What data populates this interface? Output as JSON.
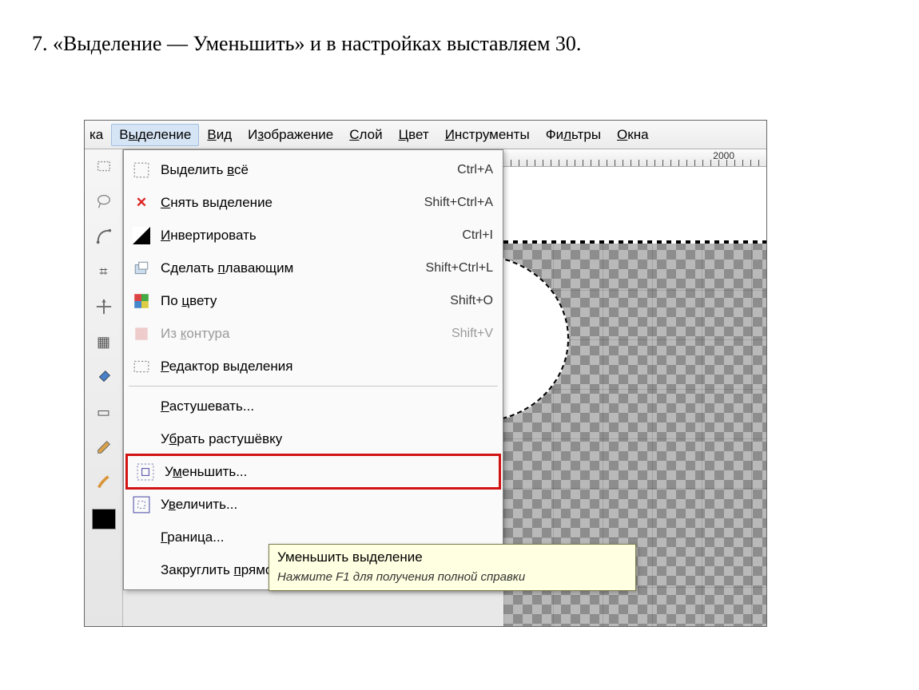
{
  "caption": "7. «Выделение — Уменьшить» и в настройках выставляем 30.",
  "menubar": {
    "partial_left": "ка",
    "items": [
      {
        "html": "В<u>ы</u>деление",
        "active": true
      },
      {
        "html": "<u>В</u>ид"
      },
      {
        "html": "И<u>з</u>ображение"
      },
      {
        "html": "<u>С</u>лой"
      },
      {
        "html": "<u>Ц</u>вет"
      },
      {
        "html": "<u>И</u>нструменты"
      },
      {
        "html": "Фи<u>л</u>ьтры"
      },
      {
        "html": "<u>О</u>кна"
      }
    ]
  },
  "ruler": {
    "label_2000": "2000"
  },
  "dropdown": {
    "items": [
      {
        "icon": "select-all-icon",
        "html": "Выделить <u>в</u>сё",
        "shortcut": "Ctrl+A"
      },
      {
        "icon": "x-icon",
        "html": "<u>С</u>нять выделение",
        "shortcut": "Shift+Ctrl+A"
      },
      {
        "icon": "invert-icon",
        "html": "<u>И</u>нвертировать",
        "shortcut": "Ctrl+I"
      },
      {
        "icon": "float-icon",
        "html": "Сделать <u>п</u>лавающим",
        "shortcut": "Shift+Ctrl+L"
      },
      {
        "icon": "by-color-icon",
        "html": "По <u>ц</u>вету",
        "shortcut": "Shift+O"
      },
      {
        "icon": "from-path-icon",
        "html": "Из <u>к</u>онтура",
        "shortcut": "Shift+V",
        "disabled": true
      },
      {
        "icon": "editor-icon",
        "html": "<u>Р</u>едактор выделения"
      },
      {
        "sep": true
      },
      {
        "icon": "",
        "html": "<u>Р</u>астушевать..."
      },
      {
        "icon": "",
        "html": "У<u>б</u>рать растушёвку"
      },
      {
        "icon": "shrink-icon",
        "html": "У<u>м</u>еньшить...",
        "highlight": true
      },
      {
        "icon": "grow-icon",
        "html": "У<u>в</u>еличить..."
      },
      {
        "icon": "",
        "html": "<u>Г</u>раница..."
      },
      {
        "icon": "",
        "html": "Закруглить <u>п</u>рямоугольник..."
      }
    ]
  },
  "tooltip": {
    "title": "Уменьшить выделение",
    "body": "Нажмите F1 для получения полной справки"
  }
}
